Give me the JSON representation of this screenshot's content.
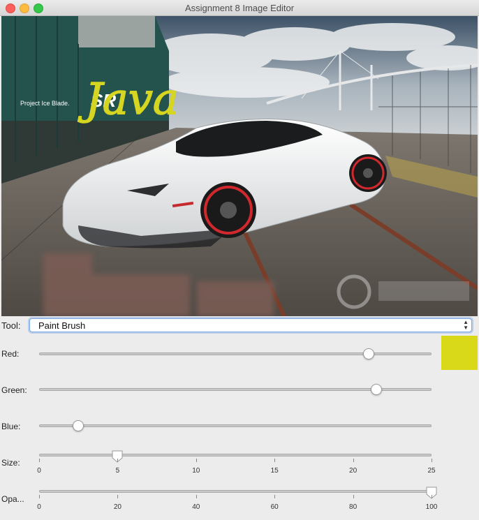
{
  "window": {
    "title": "Assignment 8 Image Editor"
  },
  "image": {
    "watermark_text": "Project Ice Blade.",
    "drawn_text": "Java",
    "drawn_color": "#d6d622",
    "logo_text": "SR"
  },
  "tool": {
    "label": "Tool:",
    "selected": "Paint Brush"
  },
  "sliders": {
    "red": {
      "label": "Red:",
      "fraction": 0.84
    },
    "green": {
      "label": "Green:",
      "fraction": 0.86
    },
    "blue": {
      "label": "Blue:",
      "fraction": 0.1
    },
    "size": {
      "label": "Size:",
      "value": 5,
      "min": 0,
      "max": 25,
      "ticks": [
        "0",
        "5",
        "10",
        "15",
        "20",
        "25"
      ]
    },
    "opacity": {
      "label": "Opa...",
      "value": 100,
      "min": 0,
      "max": 100,
      "ticks": [
        "0",
        "20",
        "40",
        "60",
        "80",
        "100"
      ]
    }
  },
  "color_preview": "#d9d91a"
}
